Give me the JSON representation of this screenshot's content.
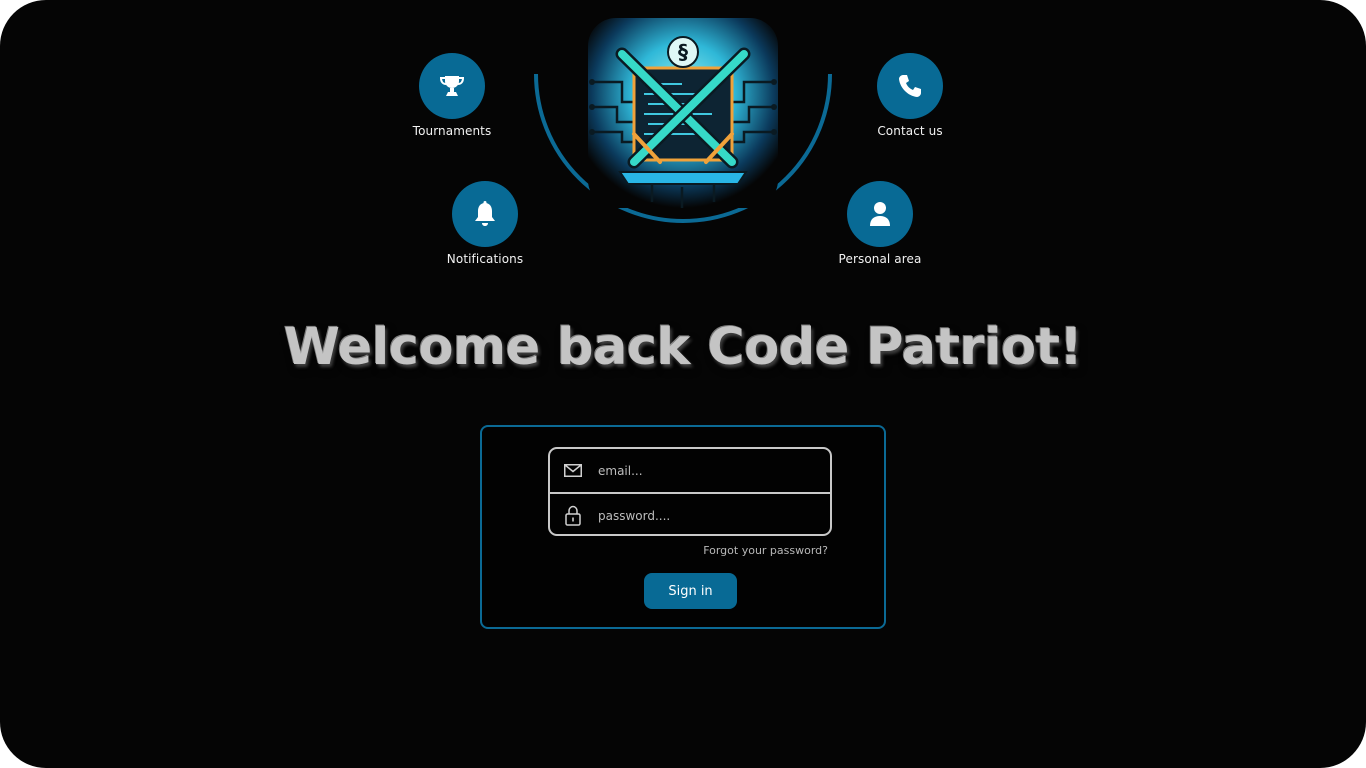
{
  "nav": {
    "tournaments": {
      "label": "Tournaments",
      "icon": "trophy-icon"
    },
    "contact": {
      "label": "Contact us",
      "icon": "phone-icon"
    },
    "notifications": {
      "label": "Notifications",
      "icon": "bell-icon"
    },
    "personal": {
      "label": "Personal area",
      "icon": "user-icon"
    }
  },
  "logo": {
    "icon": "code-swords-logo",
    "glyph": "§"
  },
  "welcome": {
    "text": "Welcome back Code Patriot!"
  },
  "login": {
    "email_placeholder": "email...",
    "email_value": "",
    "password_placeholder": "password....",
    "password_value": "",
    "forgot_label": "Forgot your password?",
    "signin_label": "Sign in"
  },
  "colors": {
    "background": "#050505",
    "accent": "#086a95",
    "field_border": "#c8c8c8",
    "heading": "#c4c4c4"
  }
}
